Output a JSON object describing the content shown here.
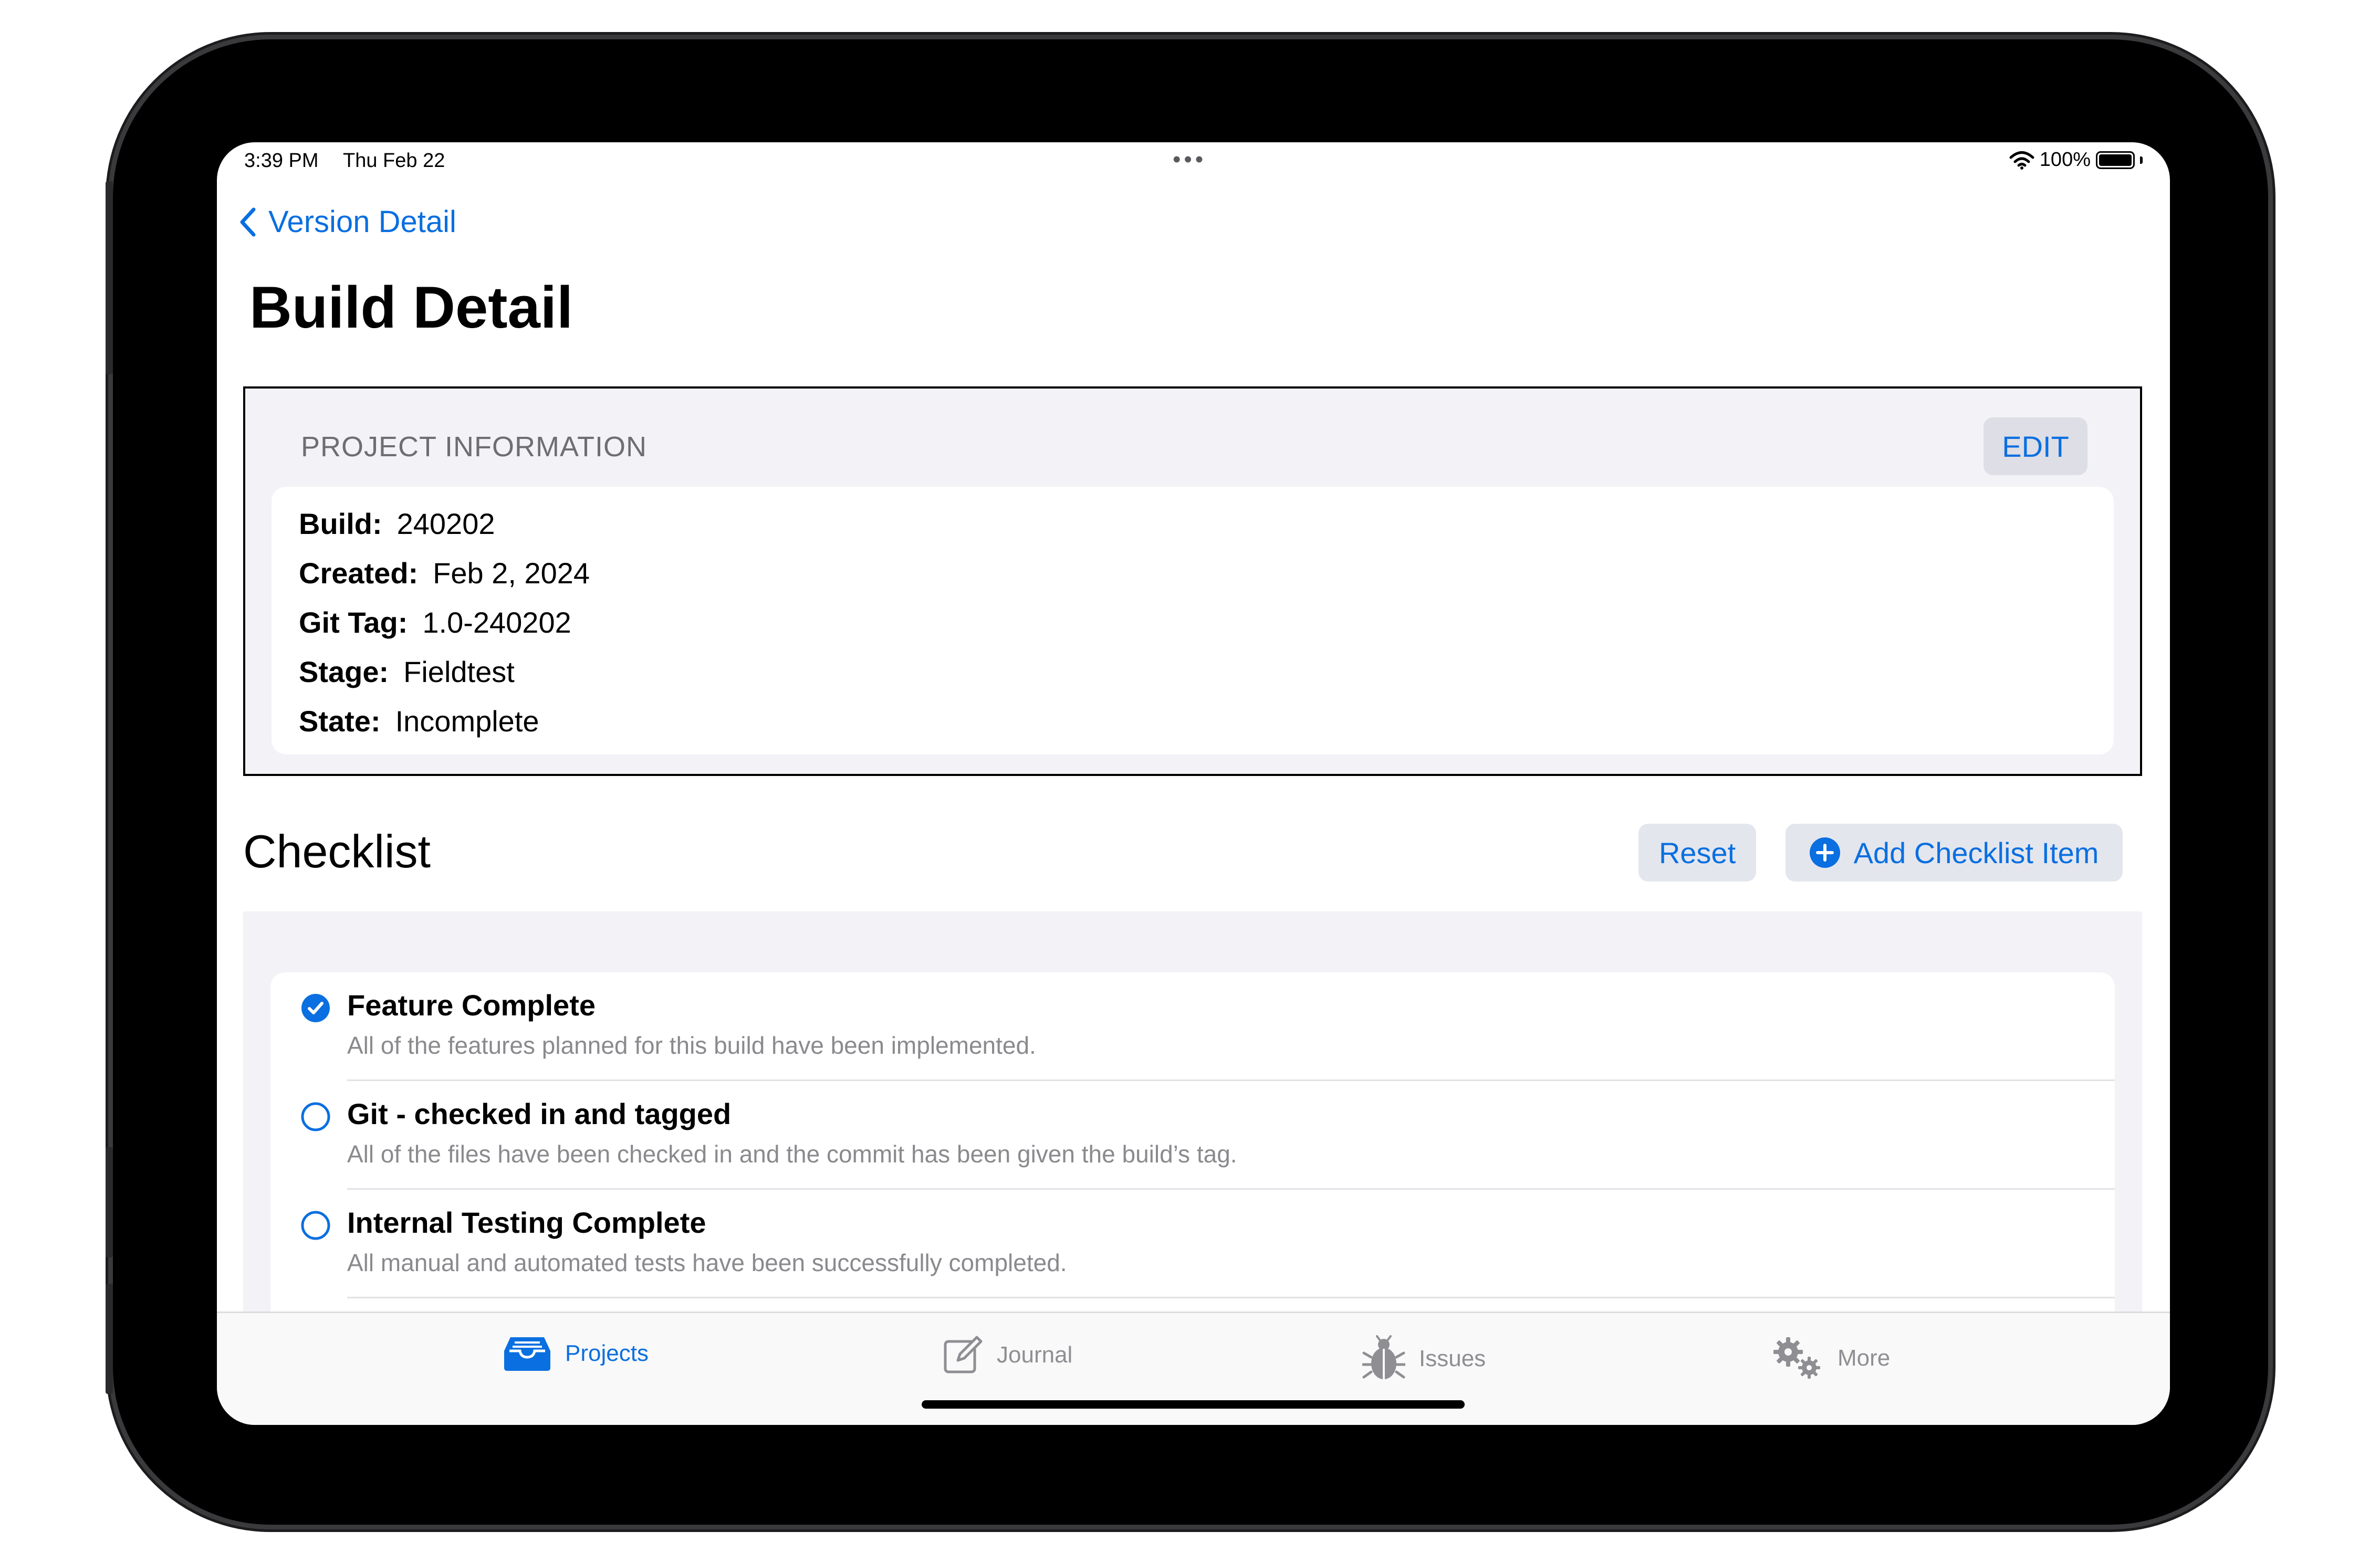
{
  "status_bar": {
    "time": "3:39 PM",
    "date": "Thu Feb 22",
    "battery": "100%",
    "battery_level": 1.0
  },
  "nav": {
    "back_label": "Version Detail"
  },
  "page": {
    "title": "Build Detail"
  },
  "project_info": {
    "header": "PROJECT INFORMATION",
    "edit_label": "EDIT",
    "rows": [
      {
        "label": "Build:",
        "value": "240202"
      },
      {
        "label": "Created:",
        "value": "Feb 2, 2024"
      },
      {
        "label": "Git Tag:",
        "value": "1.0-240202"
      },
      {
        "label": "Stage:",
        "value": "Fieldtest"
      },
      {
        "label": "State:",
        "value": "Incomplete"
      }
    ]
  },
  "checklist": {
    "title": "Checklist",
    "reset_label": "Reset",
    "add_label": "Add Checklist Item",
    "items": [
      {
        "title": "Feature Complete",
        "description": "All of the features planned for this build have been implemented.",
        "checked": true
      },
      {
        "title": "Git - checked in and tagged",
        "description": "All of the files have been checked in and the commit has been given the build’s tag.",
        "checked": false
      },
      {
        "title": "Internal Testing Complete",
        "description": "All manual and automated tests have been successfully completed.",
        "checked": false
      }
    ]
  },
  "tabs": [
    {
      "label": "Projects",
      "icon": "tray-icon",
      "active": true
    },
    {
      "label": "Journal",
      "icon": "compose-icon",
      "active": false
    },
    {
      "label": "Issues",
      "icon": "ladybug-icon",
      "active": false
    },
    {
      "label": "More",
      "icon": "gears-icon",
      "active": false
    }
  ],
  "colors": {
    "accent": "#0a6fe0",
    "grouped_background": "#f2f2f7",
    "secondary_text": "#8a8a8e",
    "inactive_tab": "#8e8e93"
  }
}
